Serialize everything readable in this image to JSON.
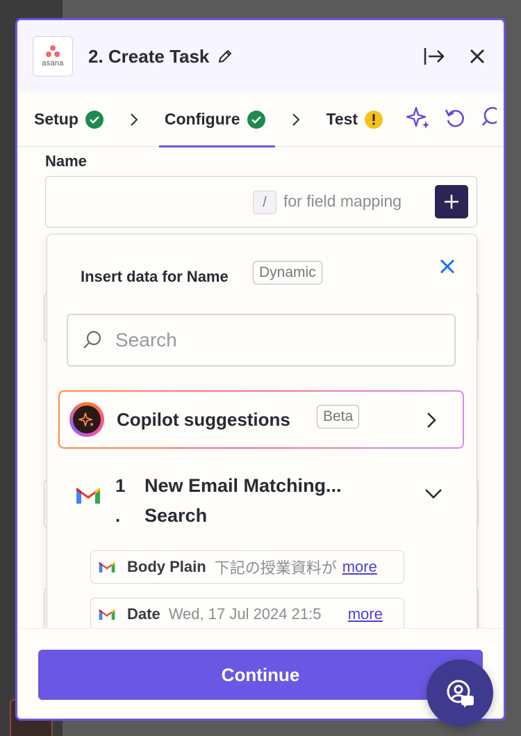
{
  "header": {
    "app_logo_text": "asana",
    "title": "2. Create Task"
  },
  "tabs": [
    {
      "label": "Setup",
      "status": "complete"
    },
    {
      "label": "Configure",
      "status": "complete"
    },
    {
      "label": "Test",
      "status": "warning"
    }
  ],
  "field": {
    "label": "Name",
    "value": "",
    "slash_key": "/",
    "mapping_hint": "for field mapping"
  },
  "popover": {
    "title": "Insert data for Name",
    "badge": "Dynamic",
    "search_placeholder": "Search",
    "copilot": {
      "label": "Copilot suggestions",
      "badge": "Beta"
    },
    "step": {
      "number": "1",
      "number_suffix": ".",
      "name": "New Email Matching... Search"
    },
    "items": [
      {
        "key": "Body Plain",
        "value": "下記の授業資料が",
        "more": "more"
      },
      {
        "key": "Date",
        "value": "Wed, 17 Jul 2024 21:5",
        "more": "more"
      }
    ]
  },
  "footer": {
    "continue_label": "Continue"
  },
  "colors": {
    "accent": "#6a57e3",
    "success": "#1e8a4f",
    "warning": "#f5c21b",
    "link": "#4b3fd6",
    "close_blue": "#1a73e8"
  },
  "icons": [
    "edit-icon",
    "exit-panel-icon",
    "close-icon",
    "checkmark-icon",
    "warning-icon",
    "chevron-right-icon",
    "sparkle-icon",
    "undo-icon",
    "comment-icon",
    "search-icon",
    "plus-icon",
    "copilot-icon",
    "gmail-icon",
    "chevron-down-icon",
    "help-icon"
  ]
}
